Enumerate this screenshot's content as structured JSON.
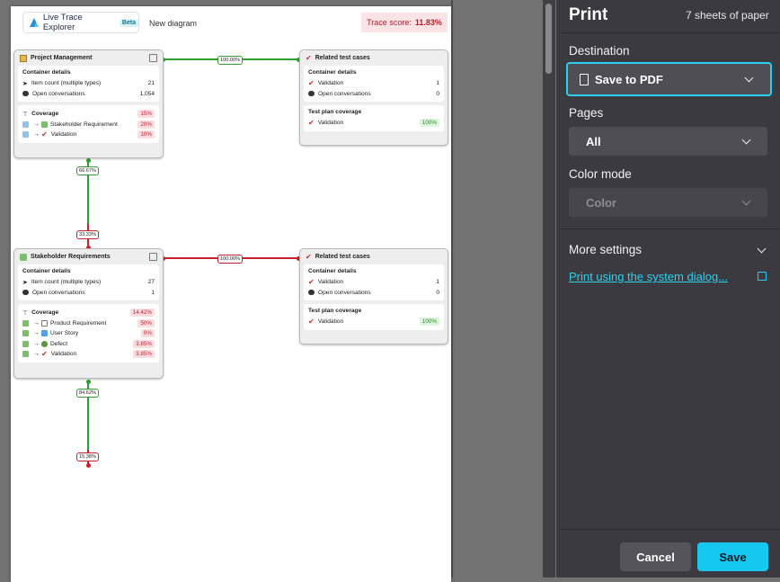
{
  "preview": {
    "app_name": "Live Trace Explorer",
    "beta_badge": "Beta",
    "new_diagram": "New diagram",
    "trace_score_label": "Trace score:",
    "trace_score_value": "11.83%",
    "cards": {
      "pm": {
        "title": "Project Management",
        "details_title": "Container details",
        "item_count_label": "Item count (multiple types)",
        "item_count": "21",
        "open_conv_label": "Open conversations",
        "open_conv": "1,054",
        "coverage_label": "Coverage",
        "coverage_value": "15%",
        "cov1_label": "Stakeholder Requirement",
        "cov1_value": "20%",
        "cov2_label": "Validation",
        "cov2_value": "10%"
      },
      "rtc1": {
        "title": "Related test cases",
        "details_title": "Container details",
        "validation_label": "Validation",
        "validation_value": "1",
        "open_conv_label": "Open conversations",
        "open_conv": "0",
        "tpc_title": "Test plan coverage",
        "tpc_label": "Validation",
        "tpc_value": "100%"
      },
      "sr": {
        "title": "Stakeholder Requirements",
        "details_title": "Container details",
        "item_count_label": "Item count (multiple types)",
        "item_count": "27",
        "open_conv_label": "Open conversations",
        "open_conv": "1",
        "coverage_label": "Coverage",
        "coverage_value": "14.42%",
        "cov1_label": "Product Requirement",
        "cov1_value": "50%",
        "cov2_label": "User Story",
        "cov2_value": "0%",
        "cov3_label": "Defect",
        "cov3_value": "3.85%",
        "cov4_label": "Validation",
        "cov4_value": "3.85%"
      },
      "rtc2": {
        "title": "Related test cases",
        "details_title": "Container details",
        "validation_label": "Validation",
        "validation_value": "1",
        "open_conv_label": "Open conversations",
        "open_conv": "0",
        "tpc_title": "Test plan coverage",
        "tpc_label": "Validation",
        "tpc_value": "100%"
      }
    },
    "links": {
      "pm_rtc": "100.00%",
      "pm_down": "66.67%",
      "sr_up": "33.33%",
      "sr_rtc": "100.00%",
      "sr_down": "84.62%",
      "bottom": "15.38%"
    },
    "colors": {
      "green": "#2e9e2e",
      "red": "#c8202c"
    }
  },
  "print": {
    "title": "Print",
    "sheets": "7 sheets of paper",
    "destination_label": "Destination",
    "destination_value": "Save to PDF",
    "pages_label": "Pages",
    "pages_value": "All",
    "color_mode_label": "Color mode",
    "color_mode_value": "Color",
    "more_settings": "More settings",
    "system_dialog_link": "Print using the system dialog...",
    "cancel": "Cancel",
    "save": "Save",
    "accent": "#16c8f0"
  }
}
